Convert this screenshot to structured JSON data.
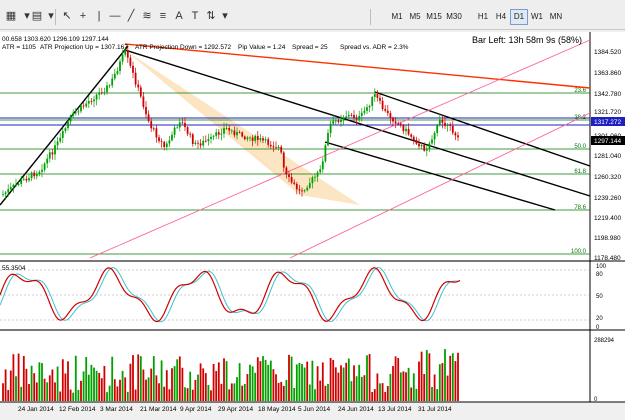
{
  "toolbar": {
    "timeframes": [
      "M1",
      "M5",
      "M15",
      "M30",
      "H1",
      "H4",
      "D1",
      "W1",
      "MN"
    ],
    "active_timeframe": "D1"
  },
  "info": {
    "ohlc": "00.658 1303.620 1296.109 1297.144",
    "atr": "ATR = 1105",
    "atr_up": "ATR Projection Up = 1307.167",
    "atr_down": "ATR Projection Down = 1292.572",
    "pip": "Pip Value = 1.24",
    "spread": "Spread = 25",
    "spread_adr": "Spread vs. ADR = 2.3%",
    "bar_left": "Bar Left: 13h 58m 9s (58%)"
  },
  "price_axis": {
    "labels": [
      "1384.520",
      "1363.860",
      "1342.780",
      "1321.720",
      "1301.060",
      "1281.040",
      "1260.320",
      "1239.260",
      "1219.400",
      "1198.980",
      "1178.480"
    ],
    "current_price": "1317.272",
    "bid_price": "1297.144"
  },
  "fib_labels": [
    "23.6",
    "38.2",
    "50.0",
    "61.8",
    "78.6",
    "100.0"
  ],
  "stoch": {
    "label": "55.3504",
    "levels": [
      "100",
      "80",
      "50",
      "20",
      "0"
    ]
  },
  "volume": {
    "max_label": "288294",
    "min_label": "0"
  },
  "dates": [
    "24 Jan 2014",
    "12 Feb 2014",
    "3 Mar 2014",
    "21 Mar 2014",
    "9 Apr 2014",
    "29 Apr 2014",
    "18 May 2014",
    "5 Jun 2014",
    "24 Jun 2014",
    "13 Jul 2014",
    "31 Jul 2014"
  ],
  "colors": {
    "bull": "#00a000",
    "bear": "#d00000",
    "wedge": "#fbe0b8",
    "fib": "#007a00",
    "red_line": "#ff3000",
    "channel": "#ff60a0",
    "blue": "#2020c0"
  }
}
